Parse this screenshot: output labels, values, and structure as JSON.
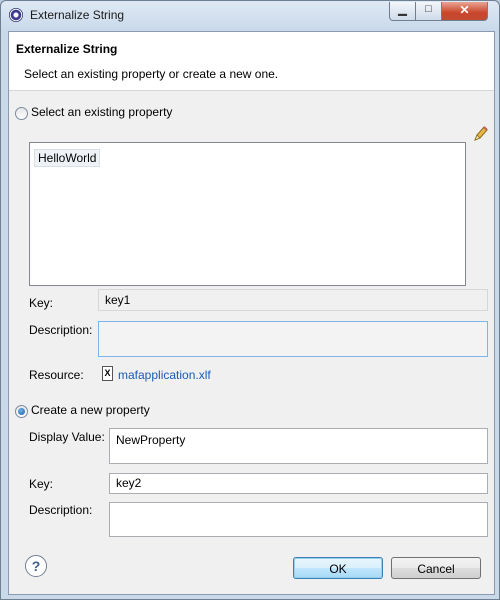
{
  "window": {
    "title": "Externalize String"
  },
  "banner": {
    "title": "Externalize String",
    "message": "Select an existing property or create a new one."
  },
  "existing": {
    "radio_label": "Select an existing property",
    "selected": false,
    "list_items": [
      "HelloWorld"
    ],
    "key_label": "Key:",
    "key_value": "key1",
    "description_label": "Description:",
    "description_value": "",
    "resource_label": "Resource:",
    "resource_value": "mafapplication.xlf"
  },
  "create": {
    "radio_label": "Create a new property",
    "selected": true,
    "display_value_label": "Display Value:",
    "display_value": "NewProperty",
    "key_label": "Key:",
    "key_value": "key2",
    "description_label": "Description:",
    "description_value": ""
  },
  "buttons": {
    "ok": "OK",
    "cancel": "Cancel",
    "help_glyph": "?"
  },
  "icons": [
    "app-icon",
    "pencil-icon",
    "xlf-file-icon",
    "help-icon"
  ]
}
